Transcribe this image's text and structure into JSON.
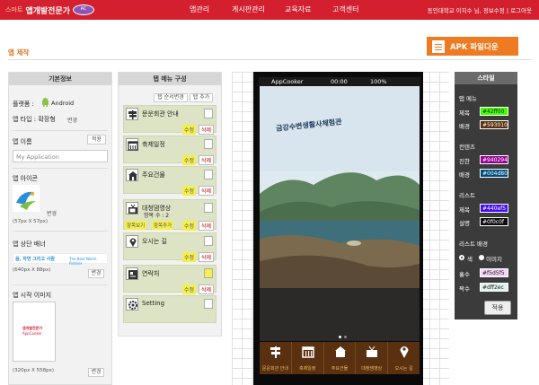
{
  "header": {
    "logo_small": "스마트",
    "logo_main": "앱개발전문가",
    "nav": [
      "앱관리",
      "게시판관리",
      "교육자료",
      "고객센터"
    ],
    "user": "동인대학교 이지수 님, 정보수정 | 로그아웃"
  },
  "page": {
    "title": "앱 제작",
    "apk_button": "APK 파일다운"
  },
  "basic": {
    "heading": "기본정보",
    "platform_label": "플랫폼 :",
    "platform_value": "Android",
    "app_type_label": "앱 타입 : 확장형",
    "change": "변경",
    "app_name_label": "앱 이름",
    "app_name_btn": "적용",
    "app_name_placeholder": "My Application",
    "icon_label": "앱 아이콘",
    "icon_change": "변경",
    "icon_size": "(57px X 57px)",
    "banner_label": "앱 상단 배너",
    "banner_logo": "음, 자연 그리고 사람",
    "banner_tag": "The Best Warm Partner",
    "banner_size": "(640px X 88px)",
    "banner_change": "변경",
    "splash_label": "앱 시작 이미지",
    "splash_size": "(320px X 558px)",
    "splash_change": "변경",
    "splash_text": "앱개발전문가",
    "splash_brand": "AppCooker"
  },
  "tabs": {
    "heading": "탭 메뉴 구성",
    "order_btn": "탭 순서변경",
    "add_btn": "탭 추가",
    "edit": "수정",
    "del": "삭제",
    "items": [
      {
        "name": "문운회관 안내"
      },
      {
        "name": "축제일정"
      },
      {
        "name": "주요건물"
      },
      {
        "name": "대청댐영상",
        "sub": "항목 수 : 2",
        "extra1": "항목보기",
        "extra2": "항목추가"
      },
      {
        "name": "오시는 길"
      },
      {
        "name": "연락처"
      },
      {
        "name": "Setting"
      }
    ]
  },
  "phone": {
    "carrier": "AppCooker",
    "time": "00:00",
    "battery": "100%",
    "overlay_text": "금강수변생활사체험관",
    "tabbar": [
      "문운회관 안내",
      "축제일정",
      "주요건물",
      "대청댐영상",
      "오시는 길"
    ]
  },
  "style": {
    "heading": "스타일",
    "tab_menu": "탭 메뉴",
    "title": "제목",
    "background": "배경",
    "content": "컨텐츠",
    "strong": "진한",
    "list": "리스트",
    "desc": "설명",
    "list_bg": "리스트 배경",
    "color": "색",
    "image": "이미지",
    "odd": "홀수",
    "even": "짝수",
    "apply": "적용",
    "colors": {
      "tab_title": "#42ff00",
      "tab_bg": "#593010",
      "content_strong": "#940294",
      "content_bg": "#004d80",
      "list_title": "#440ef5",
      "list_desc": "#0f0c0f",
      "odd_bg": "#f5d5f5",
      "even_bg": "#dff2ec"
    }
  }
}
